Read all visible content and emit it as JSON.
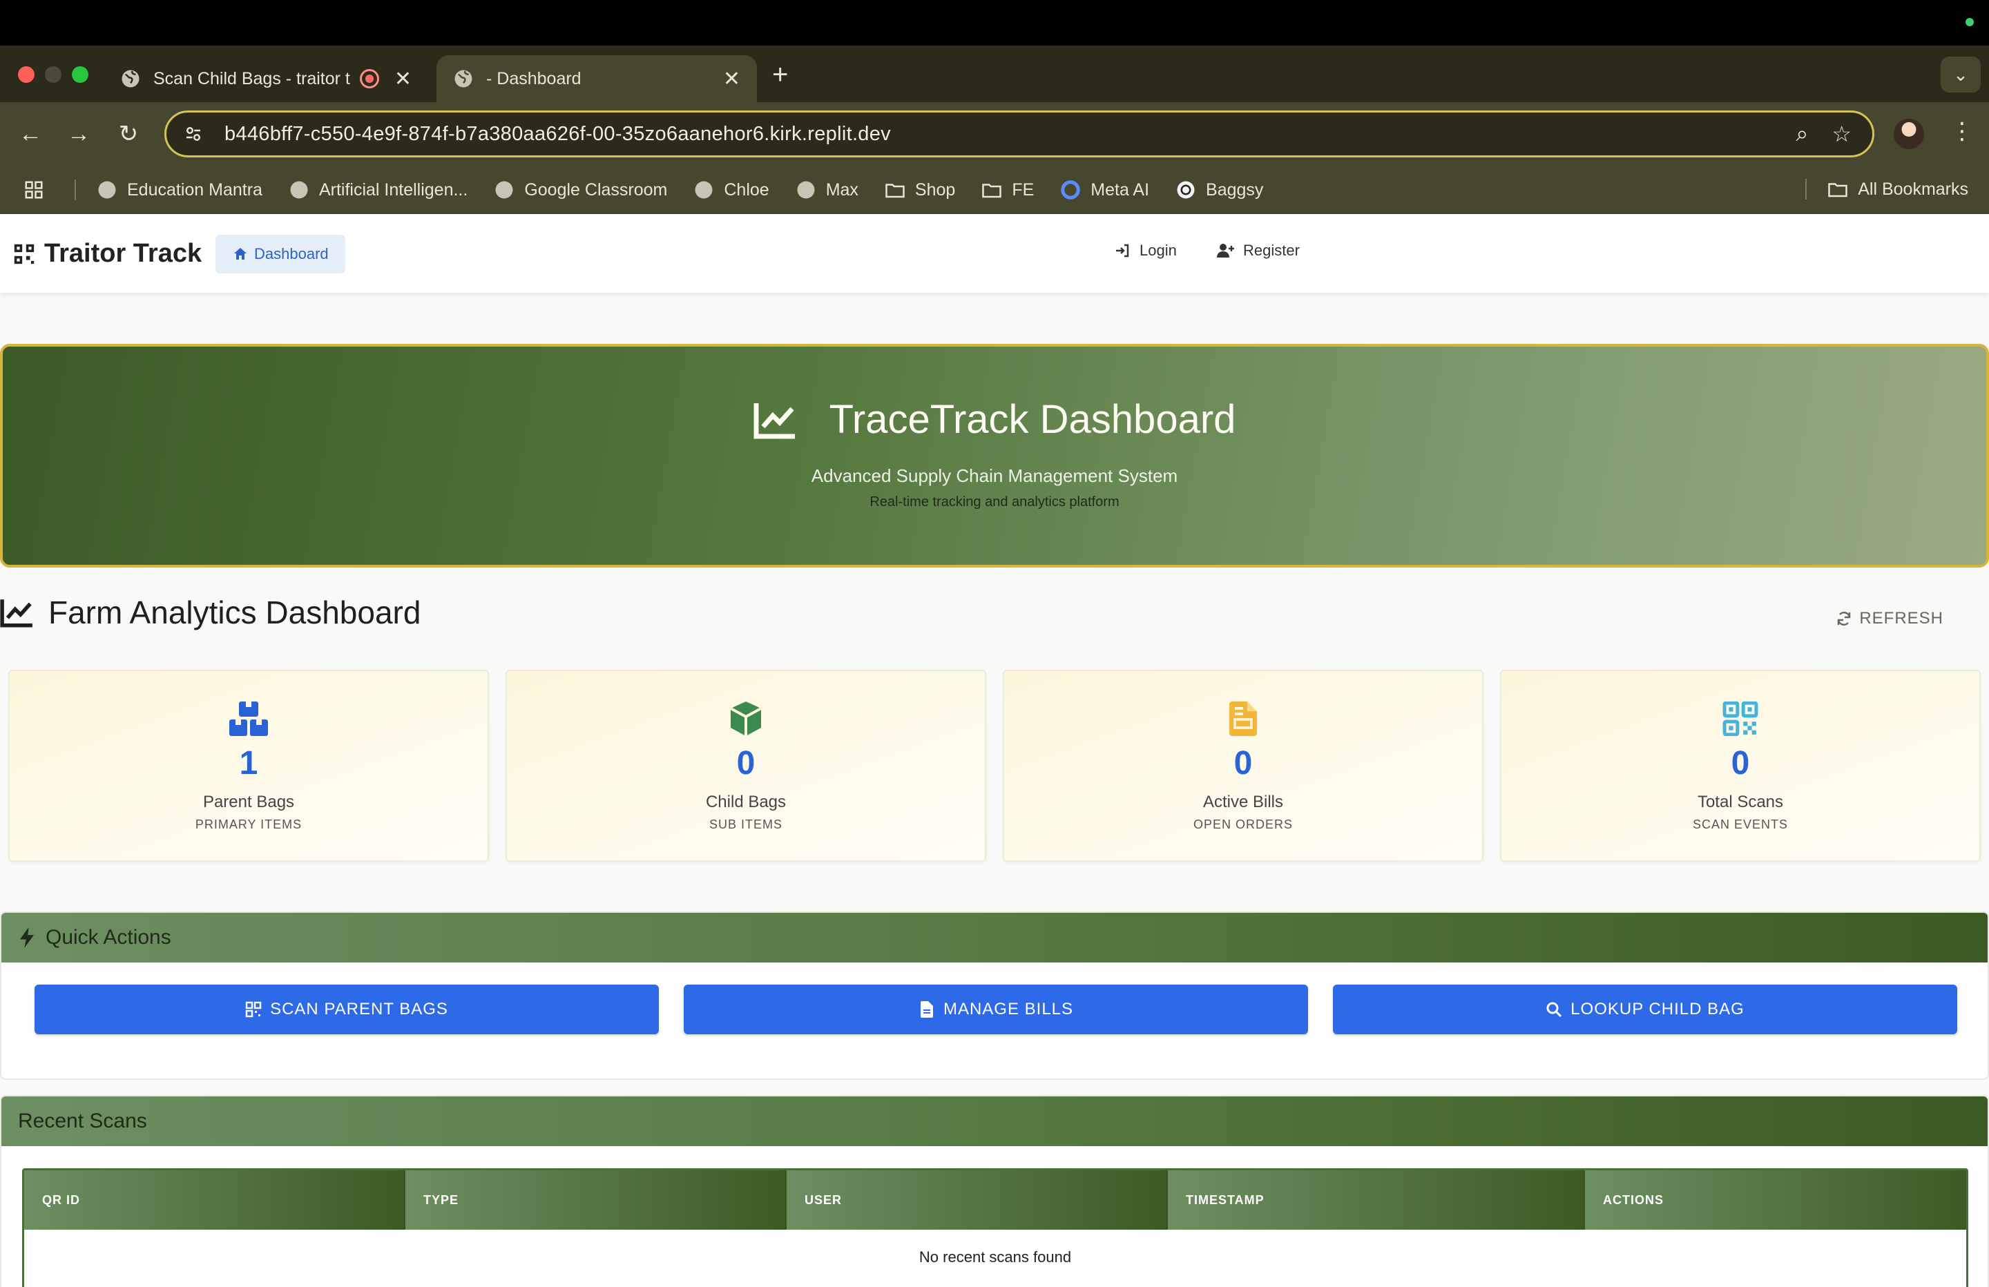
{
  "browser": {
    "tabs": [
      {
        "title": "Scan Child Bags - traitor t",
        "active": false
      },
      {
        "title": "- Dashboard",
        "active": true
      }
    ],
    "new_tab_label": "+",
    "tab_menu_icon": "chevron-down",
    "url": "b446bff7-c550-4e9f-874f-b7a380aa626f-00-35zo6aanehor6.kirk.replit.dev",
    "bookmarks": [
      "Education Mantra",
      "Artificial Intelligen...",
      "Google Classroom",
      "Chloe",
      "Max",
      "Shop",
      "FE",
      "Meta AI",
      "Baggsy"
    ],
    "all_bookmarks": "All Bookmarks"
  },
  "navbar": {
    "brand": "Traitor Track",
    "dashboard_link": "Dashboard",
    "login": "Login",
    "register": "Register"
  },
  "hero": {
    "title": "TraceTrack Dashboard",
    "subtitle": "Advanced Supply Chain Management System",
    "tagline": "Real-time tracking and analytics platform"
  },
  "analytics": {
    "title": "Farm Analytics Dashboard",
    "refresh": "REFRESH"
  },
  "stats": [
    {
      "value": "1",
      "label": "Parent Bags",
      "sub": "PRIMARY ITEMS",
      "icon": "boxes-icon",
      "color": "#2b63d4"
    },
    {
      "value": "0",
      "label": "Child Bags",
      "sub": "SUB ITEMS",
      "icon": "box-icon",
      "color": "#3d8a4f"
    },
    {
      "value": "0",
      "label": "Active Bills",
      "sub": "OPEN ORDERS",
      "icon": "file-invoice-icon",
      "color": "#f2b73a"
    },
    {
      "value": "0",
      "label": "Total Scans",
      "sub": "SCAN EVENTS",
      "icon": "qrcode-icon",
      "color": "#45b4dc"
    }
  ],
  "quick_actions": {
    "title": "Quick Actions",
    "buttons": [
      "SCAN PARENT BAGS",
      "MANAGE BILLS",
      "LOOKUP CHILD BAG"
    ]
  },
  "recent_scans": {
    "title": "Recent Scans",
    "columns": [
      "QR ID",
      "TYPE",
      "USER",
      "TIMESTAMP",
      "ACTIONS"
    ],
    "empty_message": "No recent scans found"
  },
  "colors": {
    "accent_blue": "#2e6ae8",
    "forest_green": "#3d5a24",
    "hero_border": "#d6b53d"
  }
}
